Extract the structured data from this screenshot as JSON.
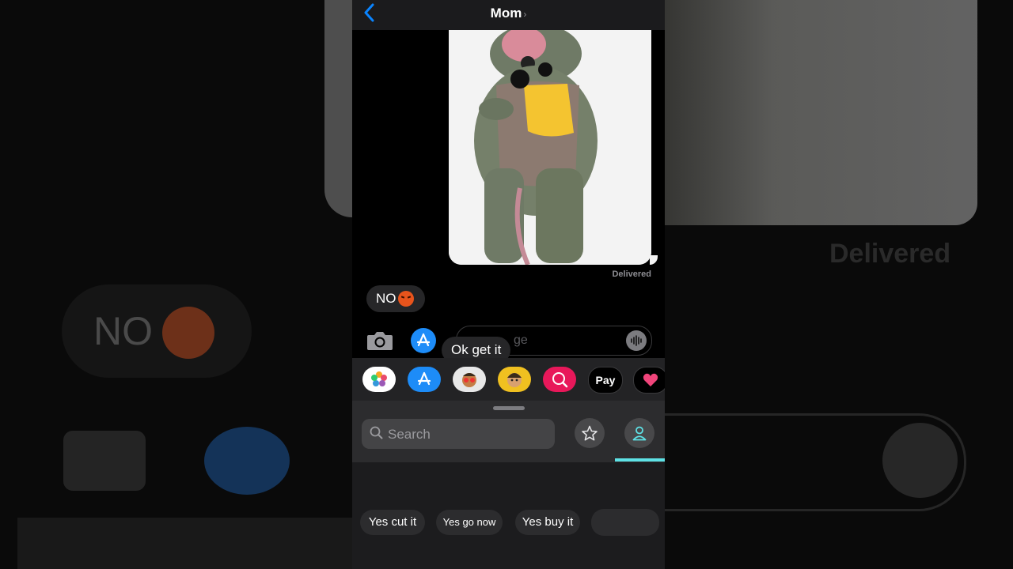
{
  "header": {
    "title": "Mom",
    "back_icon": "chevron-left-icon"
  },
  "conversation": {
    "delivered_label": "Delivered",
    "incoming_message": {
      "text": "NO",
      "emoji": "angry-face-emoji"
    }
  },
  "compose": {
    "placeholder": "iMessage",
    "placeholder_visible": "ge",
    "tooltip": "Ok get it"
  },
  "app_tray": {
    "apps": [
      "photos-app-icon",
      "app-store-icon",
      "memoji-stickers-icon",
      "memoji-icon",
      "search-images-icon",
      "apple-pay-icon",
      "digital-touch-icon"
    ],
    "apple_pay_label": "Pay"
  },
  "drawer": {
    "search_placeholder": "Search",
    "suggestions": [
      "Yes cut it",
      "Yes go now",
      "Yes buy it"
    ]
  },
  "colors": {
    "accent": "#0a84ff",
    "tab_indicator": "#5ee2e6",
    "app_store": "#1d8cf8"
  }
}
